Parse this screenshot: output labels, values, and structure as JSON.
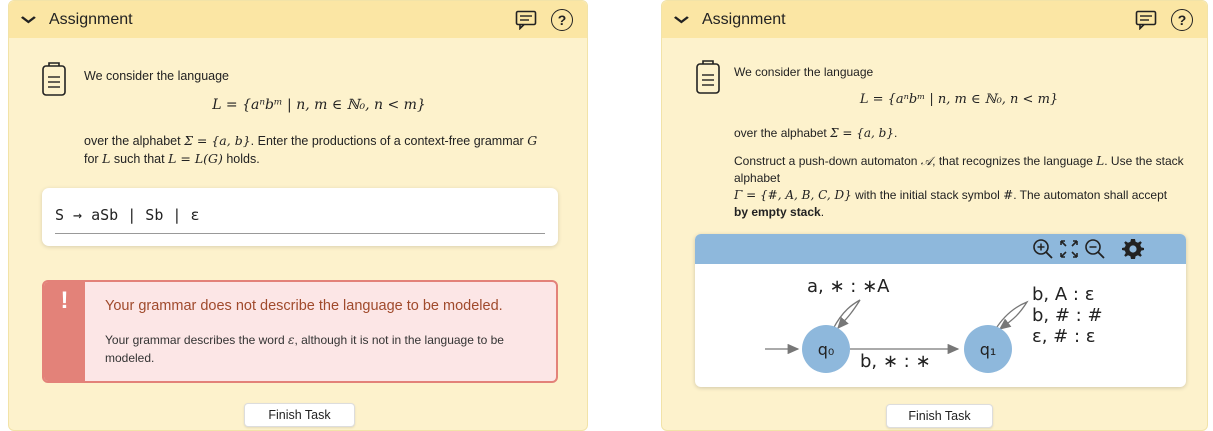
{
  "left_panel": {
    "header": {
      "title": "Assignment",
      "help_label": "?"
    },
    "intro": "We consider the language",
    "formula": "L = {aⁿbᵐ | n, m ∈ ℕ₀, n < m}",
    "desc_line1_pre": "over the alphabet",
    "desc_alphabet": "Σ = {a, b}",
    "desc_line1_post": ". Enter the productions of a context-free grammar",
    "desc_G": "G",
    "desc_line2_for": "for",
    "desc_L1": "L",
    "desc_line2_mid": "such that",
    "desc_eq": "L = L(G)",
    "desc_line2_post": "holds.",
    "input_value": "S → aSb | Sb | ε",
    "error": {
      "mark": "!",
      "title": "Your grammar does not describe the language to be modeled.",
      "text_pre": "Your grammar describes the word",
      "text_word": "ε",
      "text_post": ", although it is not in the language to be modeled."
    },
    "finish_label": "Finish Task"
  },
  "right_panel": {
    "header": {
      "title": "Assignment",
      "help_label": "?"
    },
    "intro": "We consider the language",
    "formula": "L = {aⁿbᵐ | n, m ∈ ℕ₀, n < m}",
    "desc_pre": "over the alphabet",
    "desc_alphabet": "Σ = {a, b}",
    "desc_post": ".",
    "task_pre": "Construct a push-down automaton",
    "task_A": "𝒜",
    "task_mid": ", that recognizes the language",
    "task_L": "L",
    "task_mid2": ". Use the stack alphabet",
    "task_gamma": "Γ = {#, A, B, C, D}",
    "task_mid3": "with the initial stack symbol",
    "task_hash": "#",
    "task_mid4": ". The automaton shall accept",
    "task_bold": "by empty stack",
    "task_end": ".",
    "automaton": {
      "state_q0": "q₀",
      "state_q1": "q₁",
      "loop_q0": "a, ∗ : ∗A",
      "edge_q0_q1": "b, ∗ : ∗",
      "loop_q1": [
        "b, A : ε",
        "b, # : #",
        "ε, # : ε"
      ]
    },
    "finish_label": "Finish Task"
  },
  "icons": [
    "chevron-down-icon",
    "feedback-icon",
    "help-icon",
    "clipboard-icon",
    "zoom-in-icon",
    "fit-view-icon",
    "zoom-out-icon",
    "gear-icon"
  ]
}
